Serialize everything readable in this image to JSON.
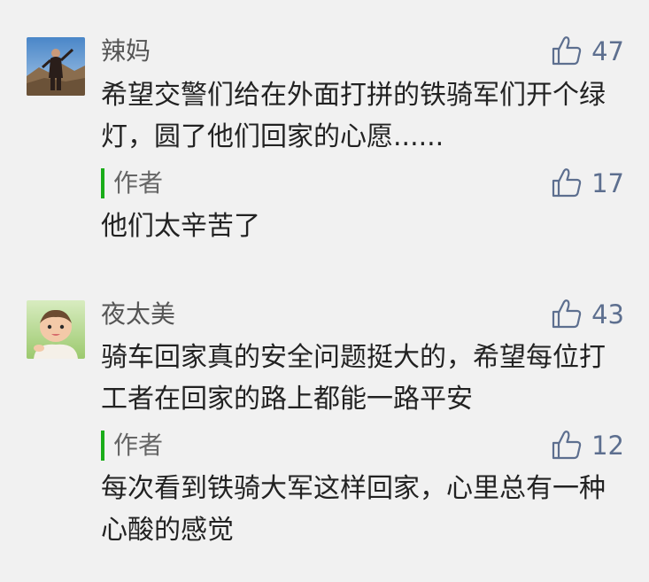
{
  "comments": [
    {
      "avatar_icon": "user-avatar-person-outdoor",
      "nickname": "辣妈",
      "like_count": "47",
      "content": "希望交警们给在外面打拼的铁骑军们开个绿灯，圆了他们回家的心愿......",
      "reply": {
        "label": "作者",
        "like_count": "17",
        "content": "他们太辛苦了"
      }
    },
    {
      "avatar_icon": "user-avatar-baby",
      "nickname": "夜太美",
      "like_count": "43",
      "content": "骑车回家真的安全问题挺大的，希望每位打工者在回家的路上都能一路平安",
      "reply": {
        "label": "作者",
        "like_count": "12",
        "content": "每次看到铁骑大军这样回家，心里总有一种心酸的感觉"
      }
    }
  ],
  "colors": {
    "background": "#f1f1f1",
    "reply_bar": "#1aad19",
    "like_count": "#5d6f8f"
  }
}
